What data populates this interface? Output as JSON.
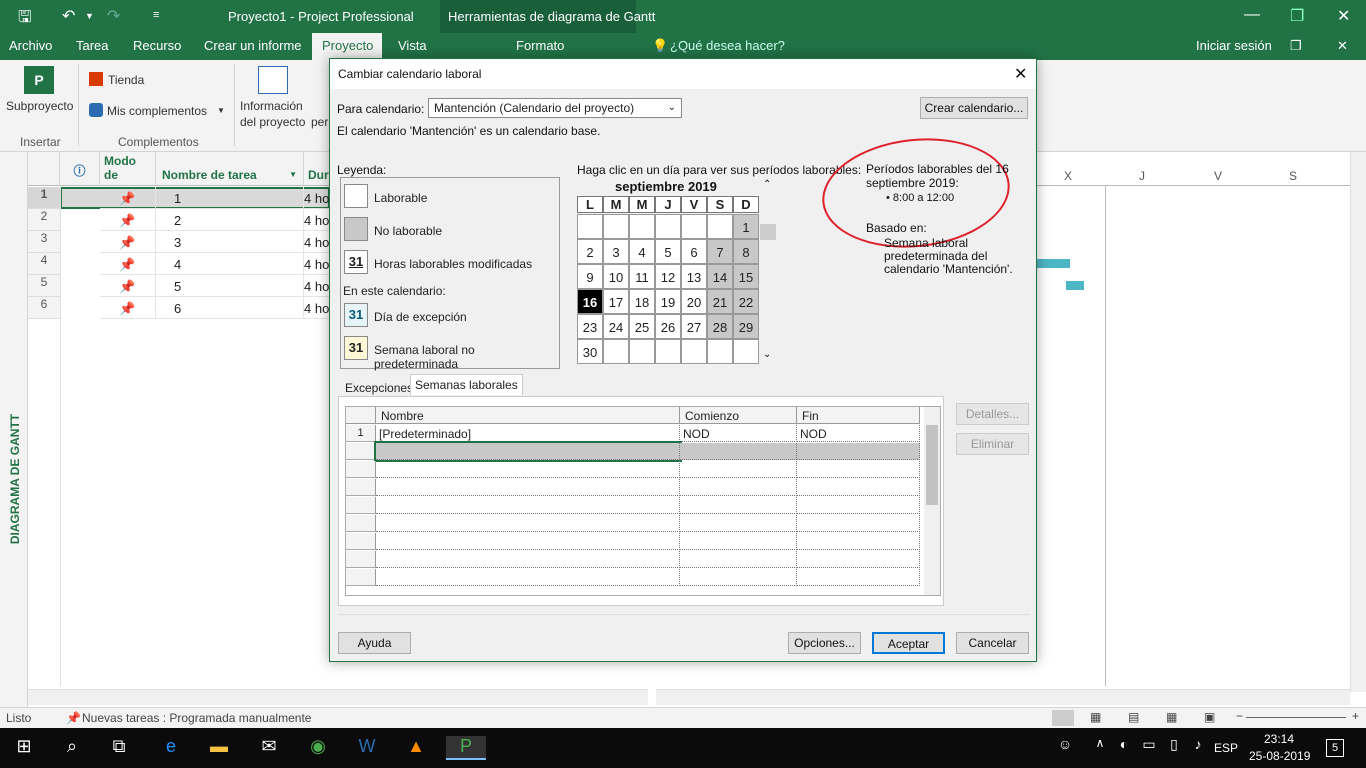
{
  "app": {
    "title": "Proyecto1 - Project Professional",
    "context_tab_title": "Herramientas de diagrama de Gantt",
    "menu": [
      "Archivo",
      "Tarea",
      "Recurso",
      "Crear un informe",
      "Proyecto",
      "Vista",
      "Formato"
    ],
    "tell_me": "¿Qué desea hacer?",
    "sign_in": "Iniciar sesión"
  },
  "ribbon": {
    "subproject": "Subproyecto",
    "store": "Tienda",
    "my_addins": "Mis complementos",
    "project_info_line1": "Información",
    "project_info_line2": "del proyecto",
    "project_info_clip": "per",
    "group_insert": "Insertar",
    "group_addins": "Complementos"
  },
  "gantt": {
    "side_label": "DIAGRAMA DE GANTT",
    "headers": {
      "mode_line1": "Modo",
      "mode_line2": "de",
      "task_name": "Nombre de tarea",
      "duration": "Dur"
    },
    "timescale": [
      "X",
      "J",
      "V",
      "S"
    ],
    "rows": [
      {
        "num": "1",
        "name": "1",
        "duration": "4 ho"
      },
      {
        "num": "2",
        "name": "2",
        "duration": "4 ho"
      },
      {
        "num": "3",
        "name": "3",
        "duration": "4 ho"
      },
      {
        "num": "4",
        "name": "4",
        "duration": "4 ho"
      },
      {
        "num": "5",
        "name": "5",
        "duration": "4 ho"
      },
      {
        "num": "6",
        "name": "6",
        "duration": "4 ho"
      }
    ]
  },
  "status": {
    "ready": "Listo",
    "new_tasks": "Nuevas tareas : Programada manualmente"
  },
  "taskbar": {
    "language": "ESP",
    "time": "23:14",
    "date": "25-08-2019",
    "notifications": "5"
  },
  "dialog": {
    "title": "Cambiar calendario laboral",
    "for_calendar_label": "Para calendario:",
    "calendar_value": "Mantención (Calendario del proyecto)",
    "create_button": "Crear calendario...",
    "base_note": "El calendario 'Mantención' es un calendario base.",
    "legend_title": "Leyenda:",
    "legend": {
      "working": "Laborable",
      "nonworking": "No laborable",
      "modified": "Horas laborables modificadas",
      "in_this_calendar": "En este calendario:",
      "exception": "Día de excepción",
      "nondefault_week": "Semana laboral no predeterminada",
      "num": "31"
    },
    "click_hint": "Haga clic en un día para ver sus períodos laborables:",
    "month": "septiembre 2019",
    "weekdays": [
      "L",
      "M",
      "M",
      "J",
      "V",
      "S",
      "D"
    ],
    "periods_title_line1": "Períodos laborables del 16",
    "periods_title_line2": "septiembre 2019:",
    "period_item": "8:00 a 12:00",
    "based_on": "Basado en:",
    "based_on_text_line1": "Semana laboral",
    "based_on_text_line2": "predeterminada del",
    "based_on_text_line3": "calendario 'Mantención'.",
    "tabs": [
      "Excepciones",
      "Semanas laborales"
    ],
    "grid_headers": {
      "name": "Nombre",
      "start": "Comienzo",
      "end": "Fin"
    },
    "grid_rows": [
      {
        "num": "1",
        "name": "[Predeterminado]",
        "start": "NOD",
        "end": "NOD"
      }
    ],
    "details_button": "Detalles...",
    "delete_button": "Eliminar",
    "help_button": "Ayuda",
    "options_button": "Opciones...",
    "ok_button": "Aceptar",
    "cancel_button": "Cancelar"
  },
  "colors": {
    "brand_green": "#217346",
    "selected_day": "#000000",
    "nonworking_day": "#c8c8c8",
    "annotation_red": "#e0202a"
  }
}
